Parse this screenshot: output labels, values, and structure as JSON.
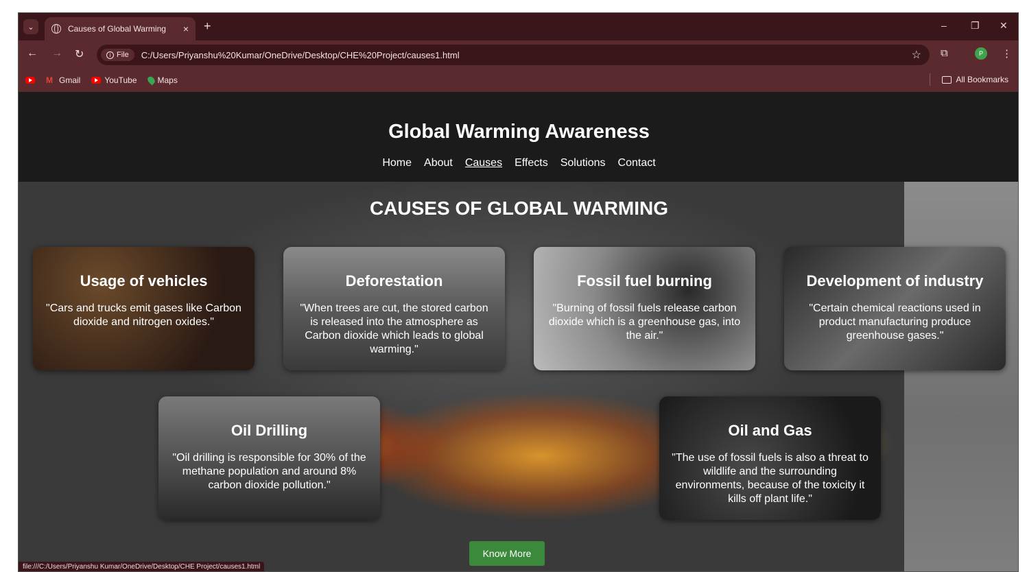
{
  "browser": {
    "tab_title": "Causes of Global Warming",
    "close_glyph": "×",
    "new_tab_glyph": "+",
    "chip_label": "File",
    "url": "C:/Users/Priyanshu%20Kumar/OneDrive/Desktop/CHE%20Project/causes1.html",
    "profile_initial": "P",
    "bookmarks": [
      "Gmail",
      "YouTube",
      "Maps"
    ],
    "all_bookmarks": "All Bookmarks",
    "status_url": "file:///C:/Users/Priyanshu Kumar/OneDrive/Desktop/CHE Project/causes1.html"
  },
  "site": {
    "title": "Global Warming Awareness",
    "nav": [
      "Home",
      "About",
      "Causes",
      "Effects",
      "Solutions",
      "Contact"
    ],
    "active_nav": "Causes"
  },
  "main": {
    "heading": "CAUSES OF GLOBAL WARMING",
    "cards": [
      {
        "title": "Usage of vehicles",
        "text": "\"Cars and trucks emit gases like Carbon dioxide and nitrogen oxides.\""
      },
      {
        "title": "Deforestation",
        "text": "\"When trees are cut, the stored carbon is released into the atmosphere as Carbon dioxide which leads to global warming.\""
      },
      {
        "title": "Fossil fuel burning",
        "text": "\"Burning of fossil fuels release carbon dioxide which is a greenhouse gas, into the air.\""
      },
      {
        "title": "Development of industry",
        "text": "\"Certain chemical reactions used in product manufacturing produce greenhouse gases.\""
      },
      {
        "title": "Oil Drilling",
        "text": "\"Oil drilling is responsible for 30% of the methane population and around 8% carbon dioxide pollution.\""
      },
      {
        "title": "Oil and Gas",
        "text": "\"The use of fossil fuels is also a threat to wildlife and the surrounding environments, because of the toxicity it kills off plant life.\""
      }
    ],
    "know_more": "Know More"
  },
  "colors": {
    "header_bg": "#1b1b1b",
    "button_green": "#3b8a3b",
    "browser_frame": "#5a2a2f"
  }
}
